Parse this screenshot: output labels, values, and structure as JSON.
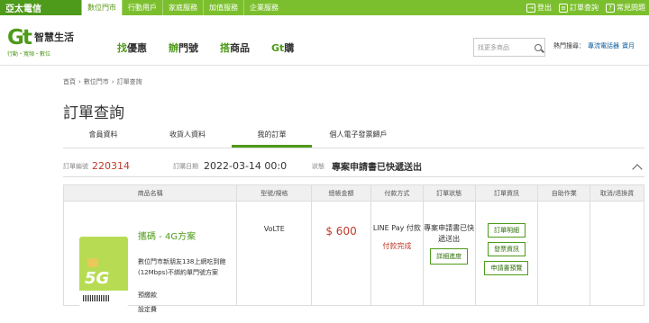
{
  "topbar": {
    "brand": "亞太電信",
    "nav": [
      "數位門市",
      "行動用戶",
      "家庭服務",
      "加值服務",
      "企業服務"
    ],
    "active_index": 0,
    "logout": "登出",
    "order_query": "訂單查詢",
    "faq": "常見問題"
  },
  "header": {
    "logo_mark": "Gt",
    "logo_name": "智慧生活",
    "slogan": "行動・寬頻・數位",
    "nav": [
      {
        "hl": "找",
        "rest": "優惠"
      },
      {
        "hl": "辦",
        "rest": "門號"
      },
      {
        "hl": "搭",
        "rest": "商品"
      },
      {
        "hl": "Gt",
        "rest": "購"
      }
    ],
    "search_placeholder": "找更多商品",
    "hot_label": "熱門搜尋：",
    "hot_keywords": [
      "專流電話器",
      "寶月"
    ]
  },
  "breadcrumb": [
    "首頁",
    "數位門市",
    "訂單查詢"
  ],
  "page_title": "訂單查詢",
  "tabs": [
    "會員資料",
    "收貨人資料",
    "我的訂單",
    "個人電子發票歸戶"
  ],
  "active_tab": 2,
  "order": {
    "no_label": "訂單編號",
    "no": "220314",
    "date_label": "訂購日期",
    "date": "2022-03-14 00:0",
    "status_label": "狀態",
    "status": "專案申請書已快遞送出"
  },
  "table": {
    "headers": [
      "商品名稱",
      "型號/規格",
      "總帳金額",
      "付款方式",
      "訂單狀態",
      "訂單資訊",
      "自助作業",
      "取消/退換貨"
    ],
    "product_name": "攜碼 - 4G方案",
    "product_desc": "數位門市新朋友138上網吃到飽(12Mbps)不綁約單門號方案",
    "product_line2": "預繳款",
    "product_line3": "設定費",
    "spec": "VoLTE",
    "price": "$ 600",
    "pay_method": "LINE Pay 付款",
    "pay_status": "付款完成",
    "order_status": "專案申請書已快遞送出",
    "detail_progress": "詳細進度",
    "info_buttons": [
      "訂單明細",
      "發票資訊",
      "申請書預覽"
    ],
    "card_badge": "5G"
  }
}
